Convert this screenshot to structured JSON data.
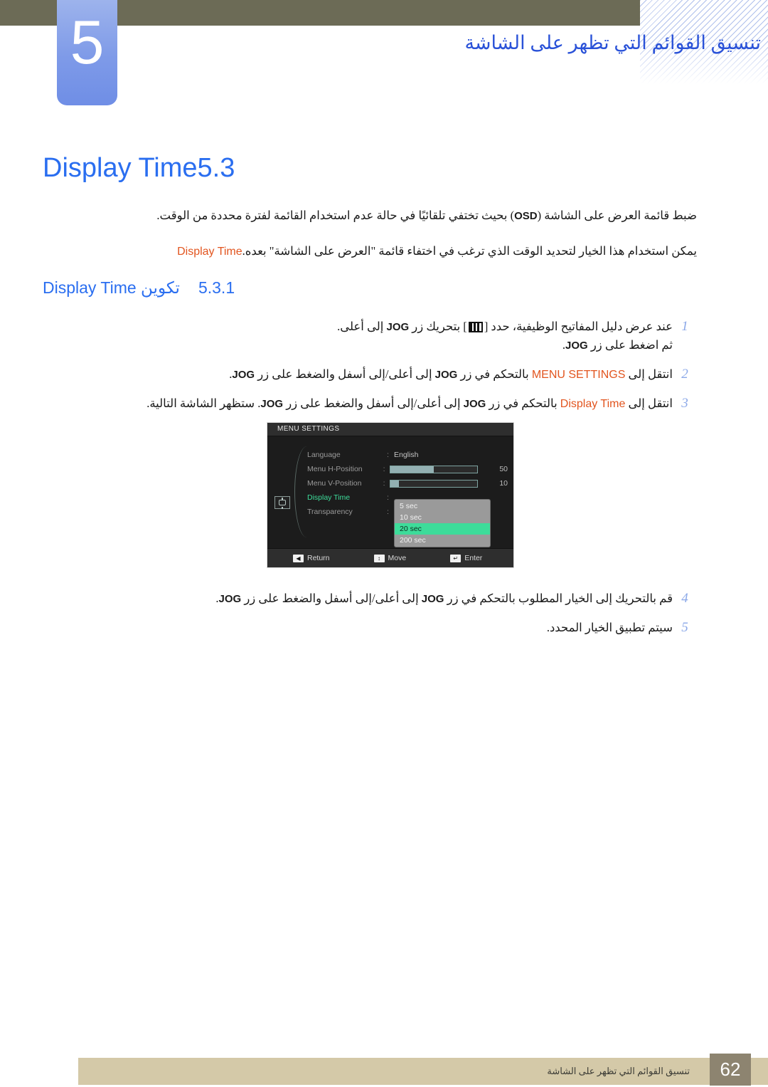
{
  "header": {
    "chapter_number": "5",
    "chapter_title": "تنسيق القوائم التي تظهر على الشاشة"
  },
  "sections": {
    "main": {
      "number": "5.3",
      "label": "Display Time"
    },
    "sub": {
      "number": "5.3.1",
      "label": "تكوين Display Time"
    }
  },
  "paragraphs": {
    "p1_before": "ضبط قائمة العرض على الشاشة (",
    "p1_kw": "OSD",
    "p1_after": ") بحيث تختفي تلقائيًا في حالة عدم استخدام القائمة لفترة محددة من الوقت.",
    "p2_kw": "Display Time",
    "p2_text": " يمكن استخدام هذا الخيار لتحديد الوقت الذي ترغب في اختفاء قائمة \"العرض على الشاشة\" بعده."
  },
  "steps": [
    {
      "num": "1",
      "line1_a": "عند عرض دليل المفاتيح الوظيفية، حدد [",
      "icon": "menu-bars-icon",
      "line1_b": "] بتحريك زر ",
      "kw1": "JOG",
      "line1_c": " إلى أعلى.",
      "line2_a": "ثم اضغط على زر ",
      "kw2": "JOG",
      "line2_b": "."
    },
    {
      "num": "2",
      "text_a": "انتقل إلى ",
      "kw_menu": "MENU SETTINGS",
      "text_b": " بالتحكم في زر ",
      "kw_jog1": "JOG",
      "text_c": " إلى أعلى/إلى أسفل والضغط على زر ",
      "kw_jog2": "JOG",
      "text_d": "."
    },
    {
      "num": "3",
      "text_a": "انتقل إلى ",
      "kw_menu": "Display Time",
      "text_b": " بالتحكم في زر ",
      "kw_jog1": "JOG",
      "text_c": " إلى أعلى/إلى أسفل والضغط على زر ",
      "kw_jog2": "JOG",
      "text_d": ". ستظهر الشاشة التالية."
    },
    {
      "num": "4",
      "text_a": "قم بالتحريك إلى الخيار المطلوب بالتحكم في زر ",
      "kw_jog1": "JOG",
      "text_c": " إلى أعلى/إلى أسفل والضغط على زر ",
      "kw_jog2": "JOG",
      "text_d": "."
    },
    {
      "num": "5",
      "text_a": "سيتم تطبيق الخيار المحدد."
    }
  ],
  "osd": {
    "title": "MENU SETTINGS",
    "category_icon": "display-settings-icon",
    "rows": [
      {
        "label": "Language",
        "kind": "value",
        "value": "English"
      },
      {
        "label": "Menu H-Position",
        "kind": "slider",
        "percent": 50,
        "number": "50"
      },
      {
        "label": "Menu V-Position",
        "kind": "slider",
        "percent": 10,
        "number": "10"
      },
      {
        "label": "Display Time",
        "kind": "dropdown",
        "active": true
      },
      {
        "label": "Transparency",
        "kind": "value",
        "value": ""
      }
    ],
    "dropdown_options": [
      {
        "label": "5 sec",
        "selected": false
      },
      {
        "label": "10 sec",
        "selected": false
      },
      {
        "label": "20 sec",
        "selected": true
      },
      {
        "label": "200 sec",
        "selected": false
      }
    ],
    "footer": {
      "return_key": "◀",
      "return_label": "Return",
      "move_key": "↕",
      "move_label": "Move",
      "enter_key": "↵",
      "enter_label": "Enter"
    }
  },
  "footer": {
    "breadcrumb": "تنسيق القوائم التي تظهر على الشاشة",
    "page_number": "62"
  },
  "colors": {
    "olive_bar": "#6c6b56",
    "chapter_badge": "#7e9ae8",
    "heading_blue": "#2a6ef0",
    "keyword_orange": "#e2551f",
    "step_number_blue": "#8ba8e8",
    "footer_bar": "#d4c9a8",
    "footer_page_box": "#8d8470",
    "osd_accent_green": "#3ddc9a"
  }
}
